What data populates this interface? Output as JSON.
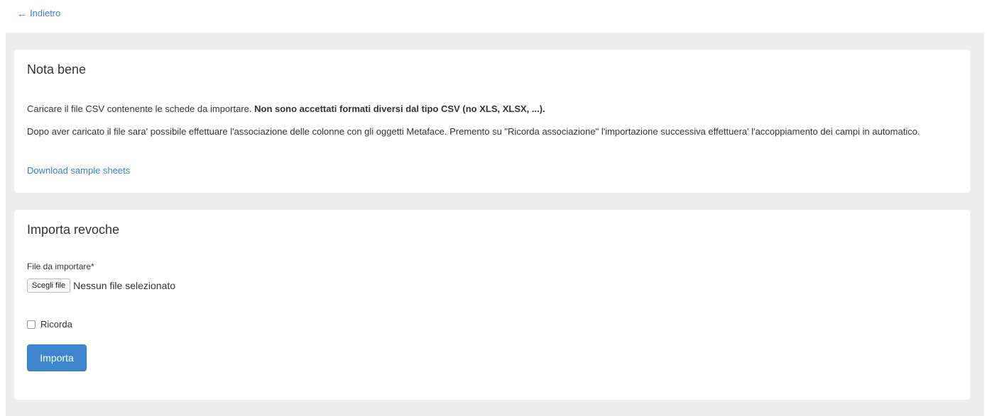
{
  "nav": {
    "back_label": "Indietro"
  },
  "nota": {
    "title": "Nota bene",
    "para1_normal": "Caricare il file CSV contenente le schede da importare. ",
    "para1_bold": "Non sono accettati formati diversi dal tipo CSV (no XLS, XLSX, ...).",
    "para2": "Dopo aver caricato il file sara' possibile effettuare l'associazione delle colonne con gli oggetti Metaface. Premento su \"Ricorda associazione\" l'importazione successiva effettuera' l'accoppiamento dei campi in automatico.",
    "sample_link": "Download sample sheets"
  },
  "import": {
    "title": "Importa revoche",
    "file_label": "File da importare*",
    "choose_button": "Scegli file",
    "file_status": "Nessun file selezionato",
    "remember_label": "Ricorda",
    "remember_checked": false,
    "submit_button": "Importa"
  },
  "colors": {
    "link": "#3a7fc4",
    "primary_button": "#3f87cc",
    "background": "#eeeeee",
    "panel": "#ffffff"
  },
  "icons": {
    "back": "arrow-left-icon"
  }
}
